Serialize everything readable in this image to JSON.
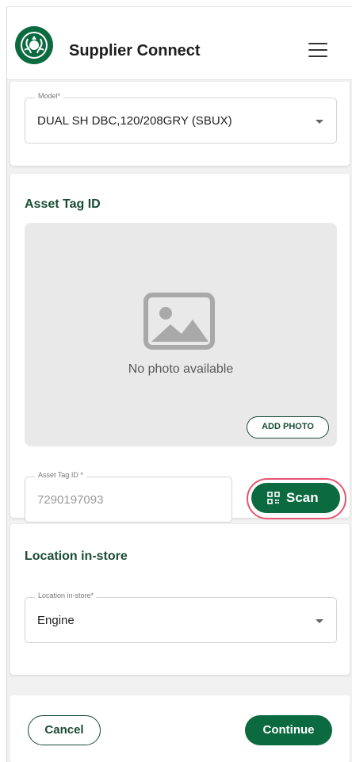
{
  "header": {
    "app_title": "Supplier Connect",
    "logo_icon": "starbucks-siren-logo",
    "menu_icon": "hamburger-menu-icon"
  },
  "model": {
    "label": "Model*",
    "value": "DUAL SH DBC,120/208GRY (SBUX)"
  },
  "asset_tag": {
    "section_title": "Asset Tag ID",
    "no_photo_text": "No photo available",
    "add_photo_label": "ADD PHOTO",
    "field_label": "Asset Tag ID *",
    "field_value": "7290197093",
    "scan_label": "Scan",
    "scan_icon": "qr-code-icon"
  },
  "location": {
    "section_title": "Location in-store",
    "field_label": "Location in-store*",
    "value": "Engine"
  },
  "actions": {
    "cancel_label": "Cancel",
    "continue_label": "Continue"
  },
  "colors": {
    "brand_green": "#0b6a3f",
    "title_green": "#1a4b35",
    "highlight_ring": "#e5566f"
  }
}
